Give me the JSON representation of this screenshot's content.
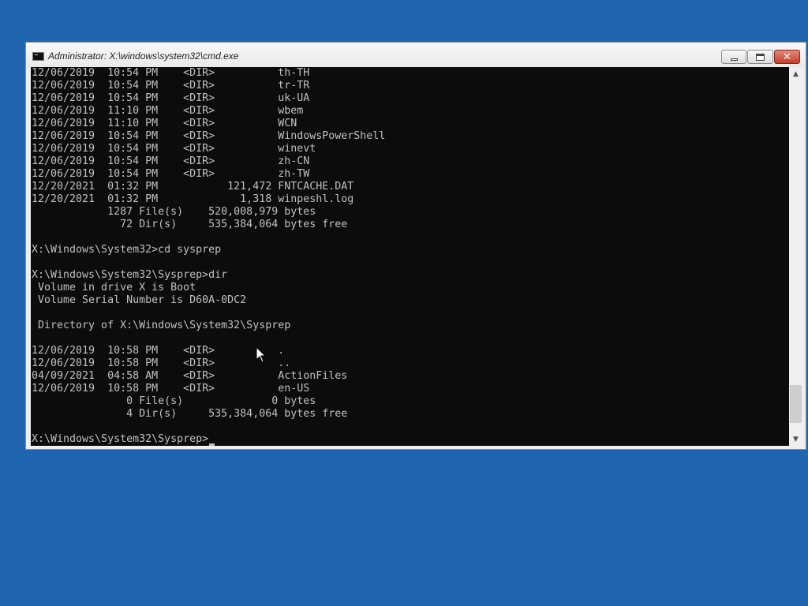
{
  "window": {
    "title": "Administrator: X:\\windows\\system32\\cmd.exe",
    "icon": "cmd-console-icon",
    "min_icon": "minimize-icon",
    "max_icon": "maximize-icon",
    "close_symbol": "✕"
  },
  "console": {
    "lines": [
      "12/06/2019  10:54 PM    <DIR>          th-TH",
      "12/06/2019  10:54 PM    <DIR>          tr-TR",
      "12/06/2019  10:54 PM    <DIR>          uk-UA",
      "12/06/2019  11:10 PM    <DIR>          wbem",
      "12/06/2019  11:10 PM    <DIR>          WCN",
      "12/06/2019  10:54 PM    <DIR>          WindowsPowerShell",
      "12/06/2019  10:54 PM    <DIR>          winevt",
      "12/06/2019  10:54 PM    <DIR>          zh-CN",
      "12/06/2019  10:54 PM    <DIR>          zh-TW",
      "12/20/2021  01:32 PM           121,472 FNTCACHE.DAT",
      "12/20/2021  01:32 PM             1,318 winpeshl.log",
      "            1287 File(s)    520,008,979 bytes",
      "              72 Dir(s)     535,384,064 bytes free",
      "",
      "X:\\Windows\\System32>cd sysprep",
      "",
      "X:\\Windows\\System32\\Sysprep>dir",
      " Volume in drive X is Boot",
      " Volume Serial Number is D60A-0DC2",
      "",
      " Directory of X:\\Windows\\System32\\Sysprep",
      "",
      "12/06/2019  10:58 PM    <DIR>          .",
      "12/06/2019  10:58 PM    <DIR>          ..",
      "04/09/2021  04:58 AM    <DIR>          ActionFiles",
      "12/06/2019  10:58 PM    <DIR>          en-US",
      "               0 File(s)              0 bytes",
      "               4 Dir(s)     535,384,064 bytes free",
      "",
      "X:\\Windows\\System32\\Sysprep>"
    ]
  },
  "scrollbar": {
    "up_symbol": "▲",
    "down_symbol": "▼",
    "position": 0.97
  },
  "colors": {
    "desktop": "#1f65b0",
    "console_bg": "#0c0c0c",
    "console_text": "#c0c0c0"
  }
}
